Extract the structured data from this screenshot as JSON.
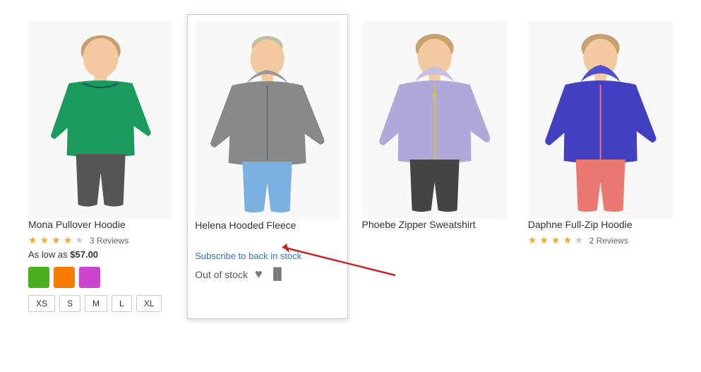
{
  "products": [
    {
      "id": "mona",
      "title": "Mona Pullover Hoodie",
      "hasRating": true,
      "stars": 4,
      "maxStars": 5,
      "reviewCount": "3  Reviews",
      "priceLabel": "As low as",
      "price": "$57.00",
      "highlighted": false,
      "swatches": [
        {
          "color": "#4caf20",
          "label": "green"
        },
        {
          "color": "#f57c00",
          "label": "orange"
        },
        {
          "color": "#cc44cc",
          "label": "magenta"
        }
      ],
      "sizes": [
        "XS",
        "S",
        "M",
        "L",
        "XL"
      ],
      "outOfStock": false,
      "showSubscribe": false,
      "figureColor": "#1a9a5c",
      "pantsColor": "#555555",
      "hairColor": "#c8a070"
    },
    {
      "id": "helena",
      "title": "Helena Hooded Fleece",
      "hasRating": false,
      "stars": 0,
      "maxStars": 5,
      "reviewCount": "",
      "priceLabel": "",
      "price": "",
      "highlighted": true,
      "swatches": [],
      "sizes": [],
      "outOfStock": true,
      "showSubscribe": true,
      "subscribeText": "Subscribe to back in stock",
      "outOfStockText": "Out of stock",
      "figureColor": "#888888",
      "pantsColor": "#7bb0e0",
      "hairColor": "#c8c8a0"
    },
    {
      "id": "phoebe",
      "title": "Phoebe Zipper Sweatshirt",
      "hasRating": false,
      "stars": 0,
      "maxStars": 5,
      "reviewCount": "",
      "priceLabel": "",
      "price": "",
      "highlighted": false,
      "swatches": [],
      "sizes": [],
      "outOfStock": false,
      "showSubscribe": false,
      "figureColor": "#b0a0d0",
      "pantsColor": "#444444",
      "hairColor": "#c8a070"
    },
    {
      "id": "daphne",
      "title": "Daphne Full-Zip Hoodie",
      "hasRating": true,
      "stars": 4,
      "maxStars": 5,
      "reviewCount": "2  Reviews",
      "priceLabel": "",
      "price": "",
      "highlighted": false,
      "swatches": [],
      "sizes": [],
      "outOfStock": false,
      "showSubscribe": false,
      "figureColor": "#4040c0",
      "pantsColor": "#e87070",
      "hairColor": "#c8a070"
    }
  ],
  "arrow": {
    "color": "#cc2222"
  }
}
